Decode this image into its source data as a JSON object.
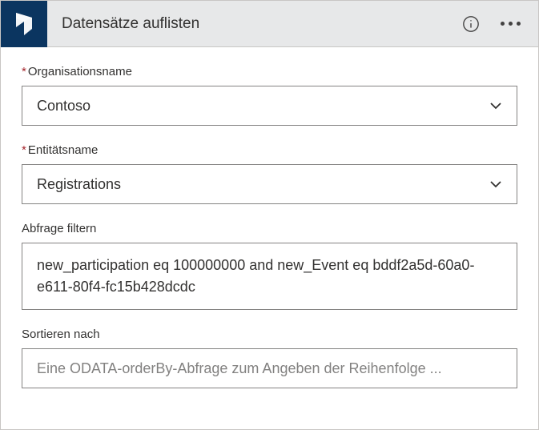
{
  "header": {
    "title": "Datensätze auflisten"
  },
  "fields": {
    "organization": {
      "label": "Organisationsname",
      "value": "Contoso"
    },
    "entity": {
      "label": "Entitätsname",
      "value": "Registrations"
    },
    "filter": {
      "label": "Abfrage filtern",
      "value": "new_participation eq 100000000 and new_Event eq bddf2a5d-60a0-e611-80f4-fc15b428dcdc"
    },
    "sort": {
      "label": "Sortieren nach",
      "placeholder": "Eine ODATA-orderBy-Abfrage zum Angeben der Reihenfolge ..."
    }
  }
}
